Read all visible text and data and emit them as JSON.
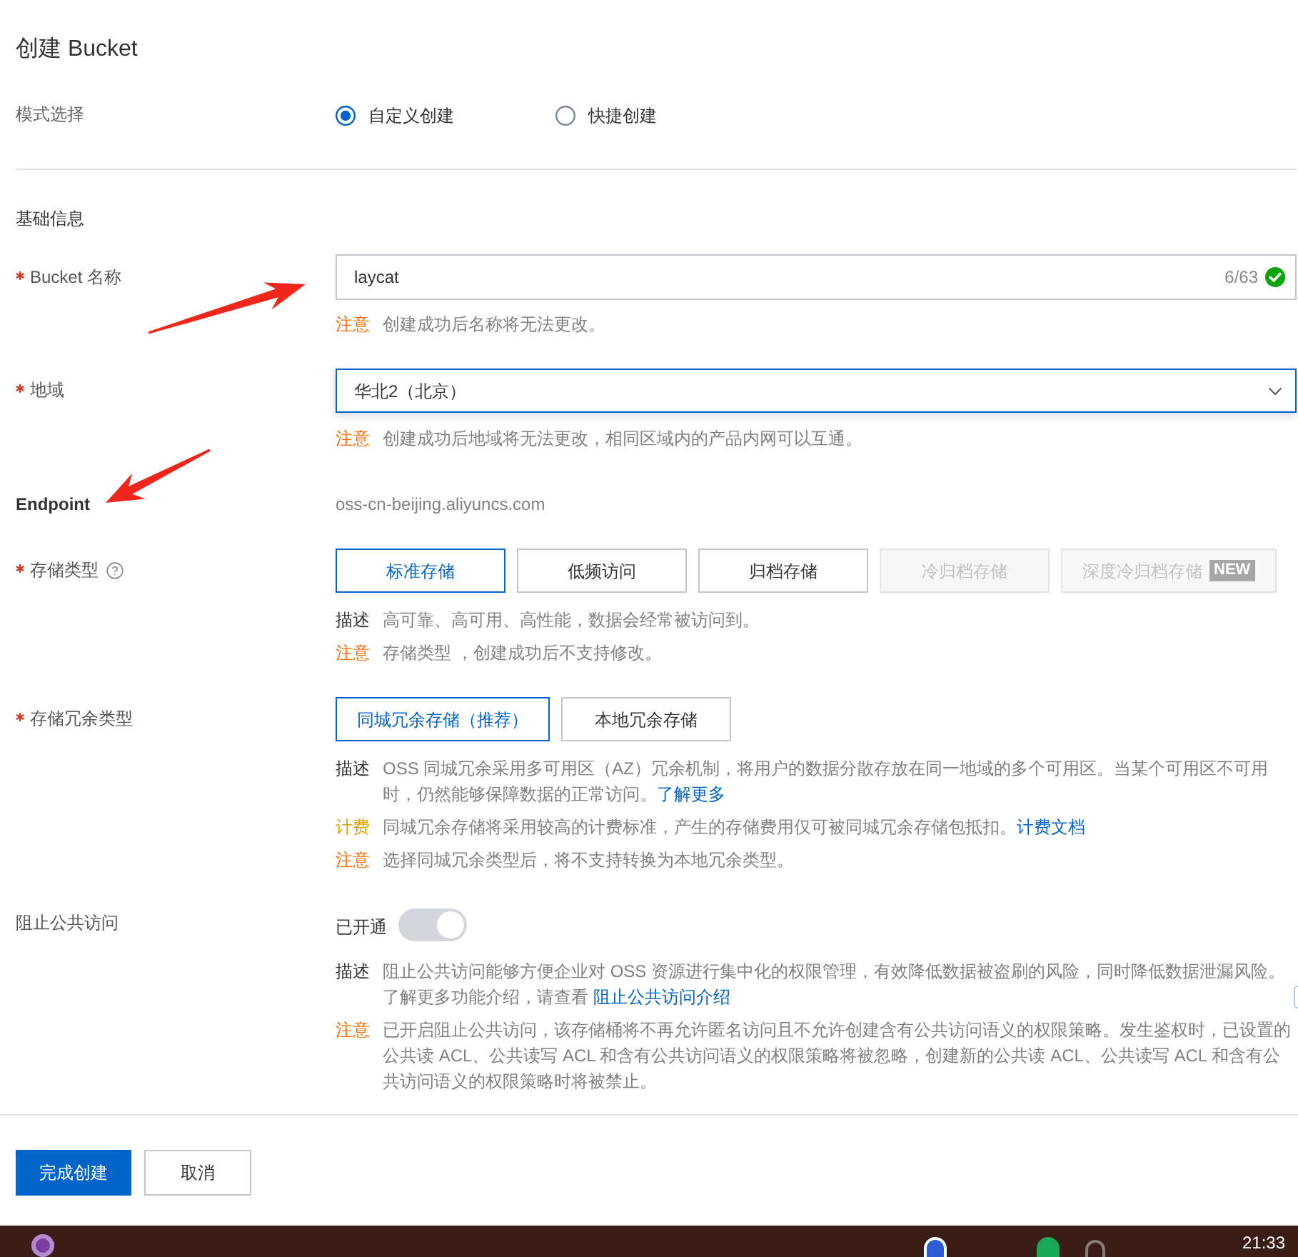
{
  "title": "创建 Bucket",
  "mode": {
    "label": "模式选择",
    "options": [
      {
        "label": "自定义创建",
        "selected": true
      },
      {
        "label": "快捷创建",
        "selected": false
      }
    ]
  },
  "section": "基础信息",
  "fields": [
    {
      "kind": "input",
      "label": "Bucket 名称",
      "required": true,
      "help": false,
      "value": "laycat",
      "counter": "6/63",
      "valid": true,
      "notes": [
        {
          "kind": "warning",
          "tag": "注意",
          "text": "创建成功后名称将无法更改。"
        }
      ]
    },
    {
      "kind": "select",
      "label": "地域",
      "required": true,
      "help": false,
      "value": "华北2（北京）",
      "focused": true,
      "notes": [
        {
          "kind": "warning",
          "tag": "注意",
          "text": "创建成功后地域将无法更改，相同区域内的产品内网可以互通。"
        }
      ]
    },
    {
      "kind": "static",
      "label": "Endpoint",
      "required": false,
      "help": false,
      "value": "oss-cn-beijing.aliyuncs.com"
    },
    {
      "kind": "choices",
      "label": "存储类型",
      "required": true,
      "help": true,
      "options": [
        {
          "label": "标准存储",
          "selected": true,
          "disabled": false
        },
        {
          "label": "低频访问",
          "selected": false,
          "disabled": false
        },
        {
          "label": "归档存储",
          "selected": false,
          "disabled": false
        },
        {
          "label": "冷归档存储",
          "selected": false,
          "disabled": true
        },
        {
          "label": "深度冷归档存储",
          "selected": false,
          "disabled": true,
          "badge": "NEW"
        }
      ],
      "notes": [
        {
          "kind": "info",
          "tag": "描述",
          "text": "高可靠、高可用、高性能，数据会经常被访问到。"
        },
        {
          "kind": "warning",
          "tag": "注意",
          "text": "存储类型 ，创建成功后不支持修改。"
        }
      ]
    },
    {
      "kind": "choices",
      "label": "存储冗余类型",
      "required": true,
      "help": false,
      "options": [
        {
          "label": "同城冗余存储（推荐）",
          "selected": true,
          "disabled": false
        },
        {
          "label": "本地冗余存储",
          "selected": false,
          "disabled": false
        }
      ],
      "notes": [
        {
          "kind": "info",
          "tag": "描述",
          "text": "OSS 同城冗余采用多可用区（AZ）冗余机制，将用户的数据分散存放在同一地域的多个可用区。当某个可用区不可用时，仍然能够保障数据的正常访问。",
          "link": "了解更多"
        },
        {
          "kind": "billing",
          "tag": "计费",
          "text": "同城冗余存储将采用较高的计费标准，产生的存储费用仅可被同城冗余存储包抵扣。",
          "link": "计费文档"
        },
        {
          "kind": "warning",
          "tag": "注意",
          "text": "选择同城冗余类型后，将不支持转换为本地冗余类型。"
        }
      ]
    },
    {
      "kind": "switch",
      "label": "阻止公共访问",
      "required": false,
      "help": false,
      "status": "已开通",
      "on": true,
      "disabled": true,
      "notes": [
        {
          "kind": "info",
          "tag": "描述",
          "text": "阻止公共访问能够方便企业对 OSS 资源进行集中化的权限管理，有效降低数据被盗刷的风险，同时降低数据泄漏风险。了解更多功能介绍，请查看 ",
          "link": "阻止公共访问介绍"
        },
        {
          "kind": "warning",
          "tag": "注意",
          "text": "已开启阻止公共访问，该存储桶将不再允许匿名访问且不允许创建含有公共访问语义的权限策略。发生鉴权时，已设置的公共读 ACL、公共读写 ACL 和含有公共访问语义的权限策略将被忽略，创建新的公共读 ACL、公共读写 ACL 和含有公共访问语义的权限策略时将被禁止。"
        }
      ]
    }
  ],
  "actions": [
    {
      "kind": "primary",
      "label": "完成创建"
    },
    {
      "kind": "default",
      "label": "取消"
    }
  ],
  "taskbar": {
    "time": "21:33"
  }
}
